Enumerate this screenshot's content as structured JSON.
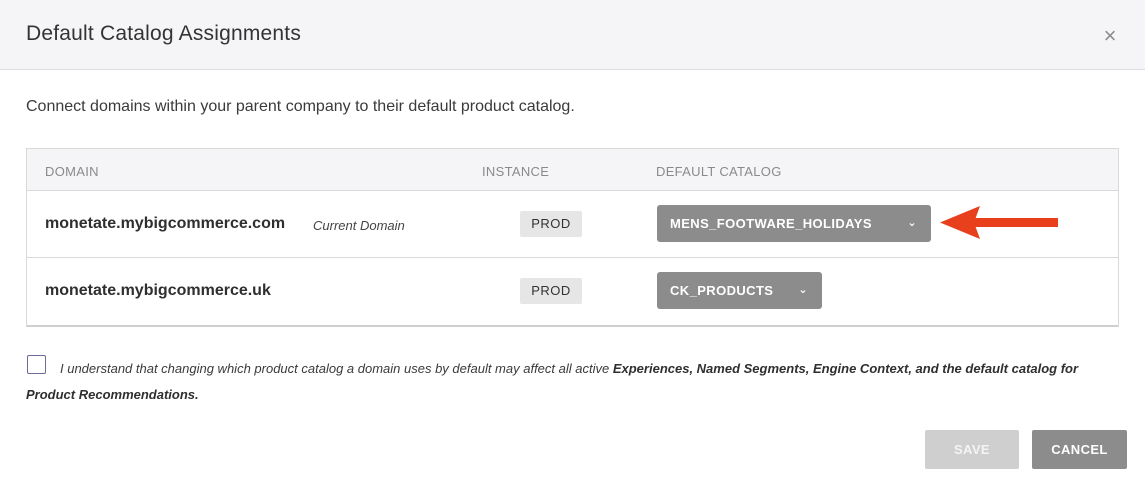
{
  "modal": {
    "title": "Default Catalog Assignments",
    "close_label": "×"
  },
  "description": "Connect domains within your parent company to their default product catalog.",
  "table": {
    "headers": [
      "DOMAIN",
      "INSTANCE",
      "DEFAULT CATALOG"
    ],
    "rows": [
      {
        "domain": "monetate.mybigcommerce.com",
        "tag": "Current Domain",
        "instance": "PROD",
        "catalog": "MENS_FOOTWARE_HOLIDAYS"
      },
      {
        "domain": "monetate.mybigcommerce.uk",
        "tag": "",
        "instance": "PROD",
        "catalog": "CK_PRODUCTS"
      }
    ]
  },
  "consent": {
    "checked": false,
    "prefix": "I understand that changing which product catalog a domain uses by default may affect all active ",
    "emphasis": "Experiences, Named Segments, Engine Context, and the default catalog for Product Recommendations."
  },
  "buttons": {
    "save": "SAVE",
    "cancel": "CANCEL"
  },
  "icons": {
    "close": "close-icon",
    "dropdown": "chevron-down-icon",
    "annotation": "red-arrow"
  },
  "colors": {
    "annotation_arrow": "#e8401c",
    "dropdown_bg": "#8c8c8c",
    "save_disabled_bg": "#cfcfcf"
  }
}
